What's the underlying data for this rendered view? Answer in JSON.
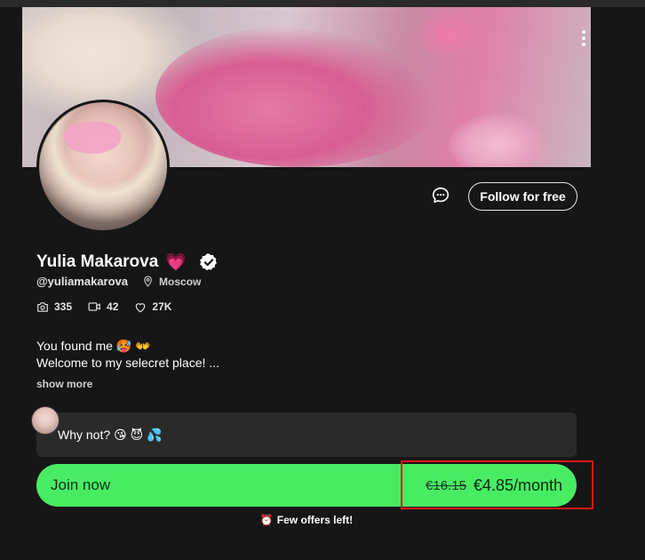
{
  "profile": {
    "name": "Yulia Makarova",
    "heart_emoji": "💗",
    "handle": "@yuliamakarova",
    "location": "Moscow",
    "verified": true
  },
  "actions": {
    "follow_label": "Follow for free",
    "message_icon": "chat-bubble-icon",
    "more_icon": "more-vertical-icon"
  },
  "stats": {
    "photos": "335",
    "videos": "42",
    "likes": "27K"
  },
  "bio": {
    "line1": "You found me 🥵 👐",
    "line2": "Welcome to my selecret place! ...",
    "show_more": "show more"
  },
  "post": {
    "text": "Why not? 😘 😈 💦"
  },
  "subscribe": {
    "join_label": "Join now",
    "old_price": "€16.15",
    "new_price": "€4.85/month",
    "offers_icon": "⏰",
    "offers_text": "Few offers left!"
  },
  "colors": {
    "background": "#161616",
    "join_button": "#48ec63",
    "highlight_border": "#e01616",
    "heart": "#ff4fa3"
  }
}
